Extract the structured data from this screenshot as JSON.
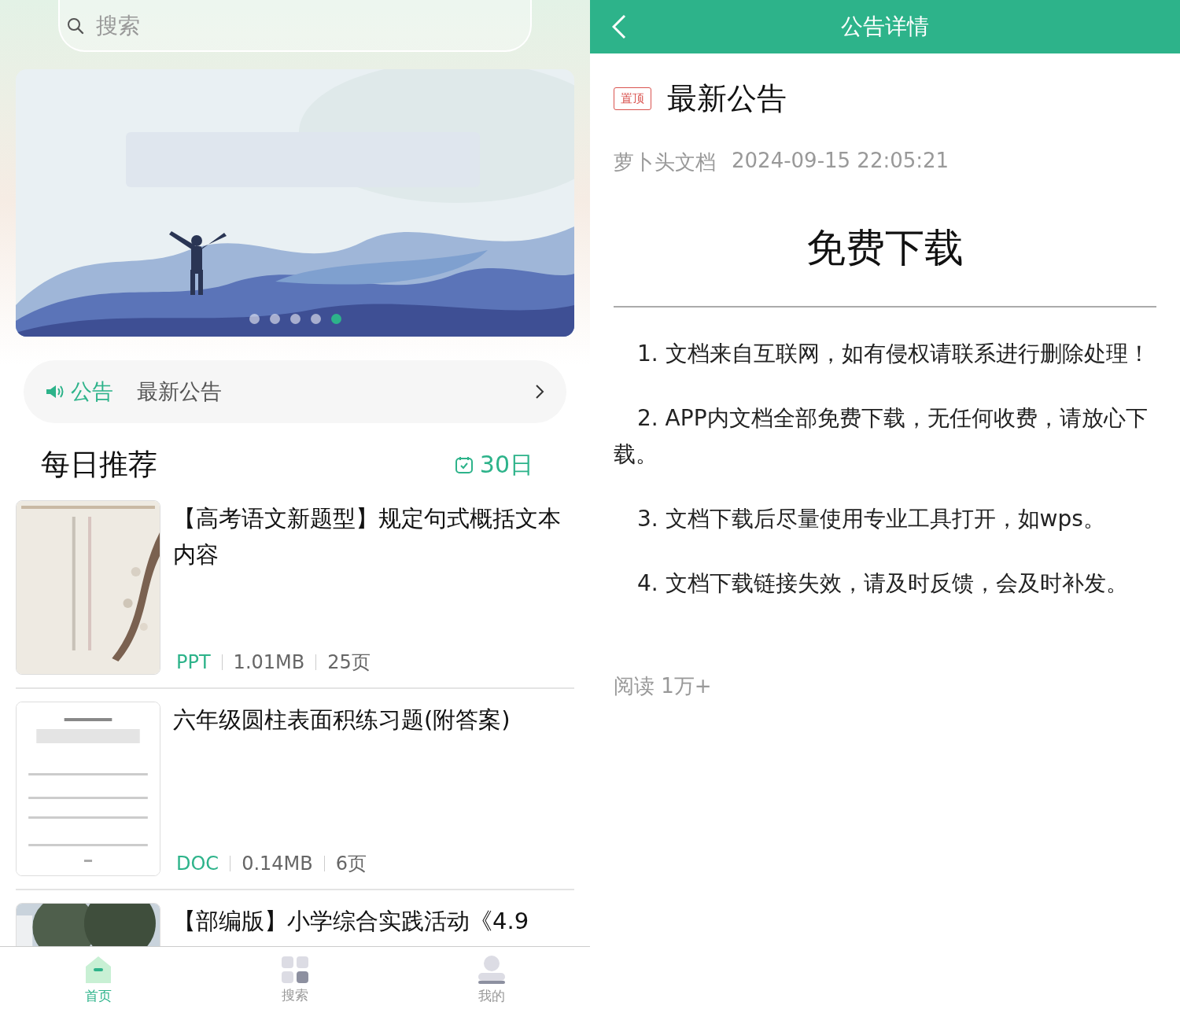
{
  "home": {
    "search": {
      "placeholder": "搜索"
    },
    "banner": {
      "kind": "picture",
      "dots": [
        {
          "selected": false
        },
        {
          "selected": false
        },
        {
          "selected": false
        },
        {
          "selected": false
        },
        {
          "selected": true
        }
      ]
    },
    "notice": {
      "label": "公告",
      "text": "最新公告"
    },
    "section": {
      "title": "每日推荐",
      "badge": "30日"
    },
    "documents": [
      {
        "title": "【高考语文新题型】规定句式概括文本内容",
        "type": "PPT",
        "size": "1.01MB",
        "pages": "25页"
      },
      {
        "title": "六年级圆柱表面积练习题(附答案)",
        "type": "DOC",
        "size": "0.14MB",
        "pages": "6页"
      },
      {
        "title": "【部编版】小学综合实践活动《4.9"
      }
    ],
    "tabs": [
      {
        "label": "首页",
        "selected": true
      },
      {
        "label": "搜索",
        "selected": false
      },
      {
        "label": "我的",
        "selected": false
      }
    ]
  },
  "detail": {
    "header": {
      "title": "公告详情"
    },
    "tag": "置顶",
    "title": "最新公告",
    "author": "萝卜头文档",
    "time": "2024-09-15 22:05:21",
    "heading": "免费下载",
    "paragraphs": [
      "1. 文档来自互联网，如有侵权请联系进行删除处理！",
      "2. APP内文档全部免费下载，无任何收费，请放心下载。",
      "3. 文档下载后尽量使用专业工具打开，如wps。",
      "4. 文档下载链接失效，请及时反馈，会及时补发。"
    ],
    "reads": "阅读 1万+"
  }
}
